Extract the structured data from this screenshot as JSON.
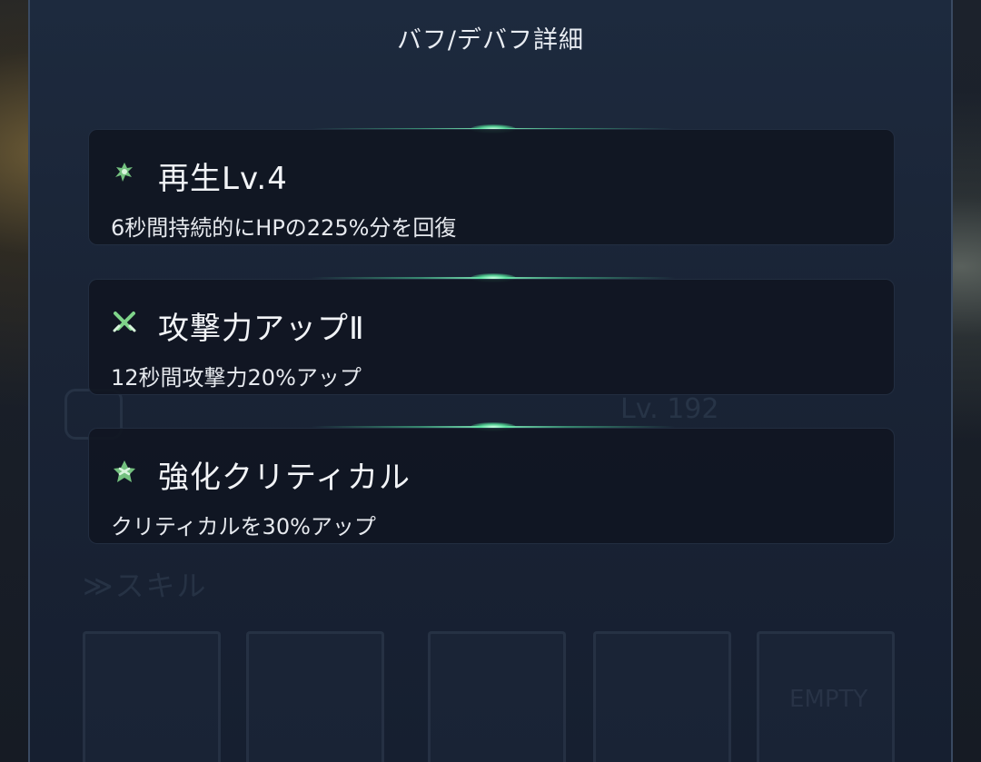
{
  "dialog": {
    "title": "バフ/デバフ詳細"
  },
  "buffs": [
    {
      "icon": "regeneration-icon",
      "name": "再生Lv.4",
      "description": "6秒間持続的にHPの225%分を回復"
    },
    {
      "icon": "crossed-swords-icon",
      "name": "攻撃力アップⅡ",
      "description": "12秒間攻撃力20%アップ"
    },
    {
      "icon": "critical-up-icon",
      "name": "強化クリティカル",
      "description": "クリティカルを30%アップ"
    }
  ],
  "background": {
    "skill_header": "≫スキル",
    "level": "Lv.  192",
    "empty_slot": "EMPTY"
  },
  "colors": {
    "panel": "#1a2436",
    "card": "#101622",
    "glow": "#5fe6a4",
    "icon_green": "#7fd48a"
  }
}
